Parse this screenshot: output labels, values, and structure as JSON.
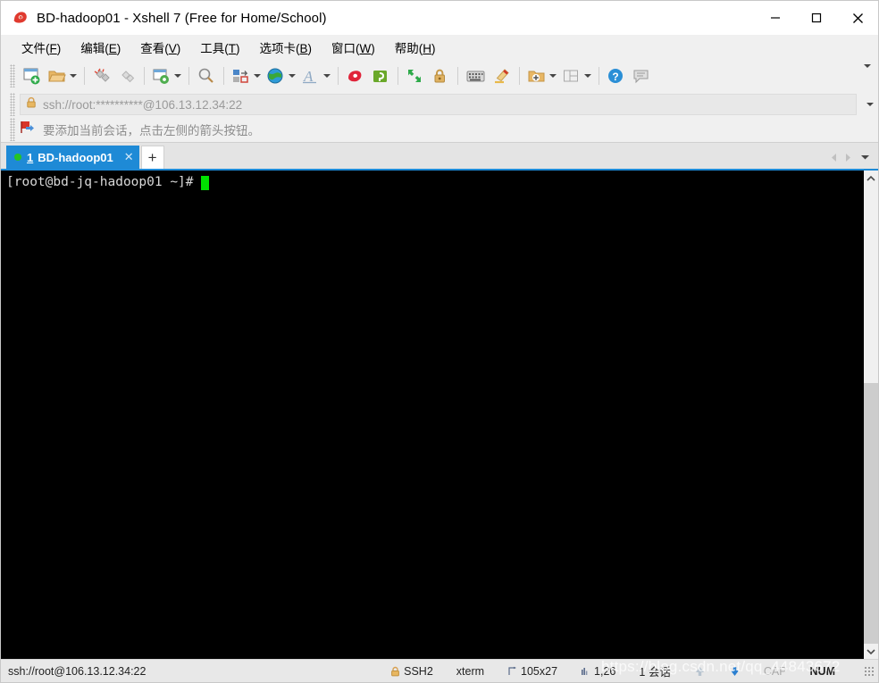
{
  "window": {
    "title": "BD-hadoop01 - Xshell 7 (Free for Home/School)",
    "logo_icon": "xshell-shell-logo-icon",
    "minimize_label": "─",
    "maximize_label": "□",
    "close_label": "✕",
    "accent_color": "#1e8ad6"
  },
  "menubar": {
    "items": [
      {
        "name": "file",
        "pre": "文件(",
        "key": "F",
        "post": ")"
      },
      {
        "name": "edit",
        "pre": "编辑(",
        "key": "E",
        "post": ")"
      },
      {
        "name": "view",
        "pre": "查看(",
        "key": "V",
        "post": ")"
      },
      {
        "name": "tools",
        "pre": "工具(",
        "key": "T",
        "post": ")"
      },
      {
        "name": "tabs",
        "pre": "选项卡(",
        "key": "B",
        "post": ")"
      },
      {
        "name": "window",
        "pre": "窗口(",
        "key": "W",
        "post": ")"
      },
      {
        "name": "help",
        "pre": "帮助(",
        "key": "H",
        "post": ")"
      }
    ]
  },
  "toolbar": {
    "buttons": [
      {
        "name": "new-session-icon",
        "has_caret": false
      },
      {
        "name": "open-session-icon",
        "has_caret": true
      },
      {
        "name": "disconnect-icon",
        "has_caret": false
      },
      {
        "name": "reconnect-icon",
        "has_caret": false
      },
      {
        "name": "session-properties-icon",
        "has_caret": true
      },
      {
        "name": "find-icon",
        "has_caret": false
      },
      {
        "name": "layout-arrange-icon",
        "has_caret": true
      },
      {
        "name": "globe-transfer-icon",
        "has_caret": true
      },
      {
        "name": "font-icon",
        "has_caret": true
      },
      {
        "name": "xshell-logo-icon",
        "has_caret": false
      },
      {
        "name": "xftp-icon",
        "has_caret": false
      },
      {
        "name": "fullscreen-icon",
        "has_caret": false
      },
      {
        "name": "lock-icon",
        "has_caret": false
      },
      {
        "name": "keyboard-icon",
        "has_caret": false
      },
      {
        "name": "highlighter-icon",
        "has_caret": false
      },
      {
        "name": "new-folder-icon",
        "has_caret": true
      },
      {
        "name": "split-view-icon",
        "has_caret": true
      },
      {
        "name": "help-icon",
        "has_caret": false
      },
      {
        "name": "chat-icon",
        "has_caret": false
      }
    ],
    "overflow_label": "▾"
  },
  "address_bar": {
    "lock_icon": "lock-icon",
    "value": "ssh://root:**********@106.13.12.34:22",
    "placeholder": "ssh://root:**********@106.13.12.34:22",
    "dropdown_label": "▾"
  },
  "notification_bar": {
    "icon": "add-to-favorites-flag-icon",
    "message": "要添加当前会话，点击左侧的箭头按钮。"
  },
  "tabbar": {
    "tabs": [
      {
        "status_dot": "connected",
        "index": "1",
        "label": "BD-hadoop01",
        "close_label": "✕",
        "active": true
      }
    ],
    "new_tab_label": "+",
    "scroll_left_label": "◀",
    "scroll_right_label": "▶",
    "tab_list_label": "▾"
  },
  "terminal": {
    "prompt": "[root@bd-jq-hadoop01 ~]#",
    "cursor": "block",
    "background": "#000000",
    "foreground": "#d8d8d8",
    "cursor_color": "#00e000",
    "scrollbar": {
      "up_label": "∧",
      "down_label": "∨"
    }
  },
  "statusbar": {
    "connection": "ssh://root@106.13.12.34:22",
    "items": [
      {
        "name": "protocol",
        "icon": "lock-icon",
        "text": "SSH2",
        "dim": false,
        "bold": false
      },
      {
        "name": "term-type",
        "icon": "",
        "text": "xterm",
        "dim": false,
        "bold": false
      },
      {
        "name": "term-size",
        "icon": "size-icon",
        "text": "105x27",
        "dim": false,
        "bold": false
      },
      {
        "name": "cursor-pos",
        "icon": "position-icon",
        "text": "1,26",
        "dim": false,
        "bold": false
      },
      {
        "name": "sessions",
        "icon": "",
        "text": "1 会话",
        "dim": false,
        "bold": false
      },
      {
        "name": "caps-lock",
        "icon": "",
        "text": "CAP",
        "dim": true,
        "bold": false
      },
      {
        "name": "num-lock",
        "icon": "",
        "text": "NUM",
        "dim": false,
        "bold": true
      }
    ],
    "watermark": "https://blog.csdn.net/qq_44843672"
  }
}
